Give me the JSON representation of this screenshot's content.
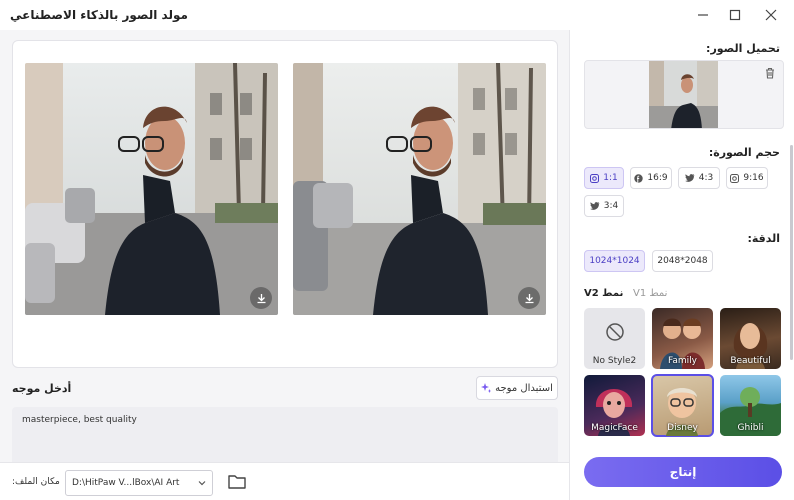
{
  "app": {
    "title": "مولد الصور بالذكاء الاصطناعي"
  },
  "window_controls": [
    "minimize-icon",
    "maximize-icon",
    "close-icon"
  ],
  "prompt": {
    "label": "أدخل موجه",
    "suggest_button": "استبدال موجه",
    "value": "masterpiece, best quality"
  },
  "footer": {
    "path_label": "مكان الملف:",
    "path_value": "D:\\HitPaw V...lBox\\AI Art"
  },
  "sidebar": {
    "upload_title": "تحميل الصور:",
    "size_title": "حجم الصورة:",
    "sizes": [
      {
        "label": "1:1",
        "icon": "instagram-icon",
        "active": true
      },
      {
        "label": "16:9",
        "icon": "facebook-icon",
        "active": false
      },
      {
        "label": "4:3",
        "icon": "twitter-icon",
        "active": false
      },
      {
        "label": "9:16",
        "icon": "instagram-icon",
        "active": false
      },
      {
        "label": "3:4",
        "icon": "twitter-icon",
        "active": false
      }
    ],
    "resolution_title": "الدقة:",
    "resolutions": [
      {
        "label": "1024*1024",
        "active": true
      },
      {
        "label": "2048*2048",
        "active": false
      }
    ],
    "tabs": [
      {
        "label": "نمط V2",
        "active": true
      },
      {
        "label": "نمط V1",
        "active": false
      }
    ],
    "styles": [
      {
        "label": "No Style2",
        "selected": false
      },
      {
        "label": "Family",
        "selected": false
      },
      {
        "label": "Beautiful",
        "selected": false
      },
      {
        "label": "MagicFace",
        "selected": false
      },
      {
        "label": "Disney",
        "selected": true
      },
      {
        "label": "Ghibli",
        "selected": false
      }
    ],
    "generate_button": "إنتاج"
  },
  "colors": {
    "accent": "#5b4fe6",
    "accent_light": "#ece9fb"
  }
}
